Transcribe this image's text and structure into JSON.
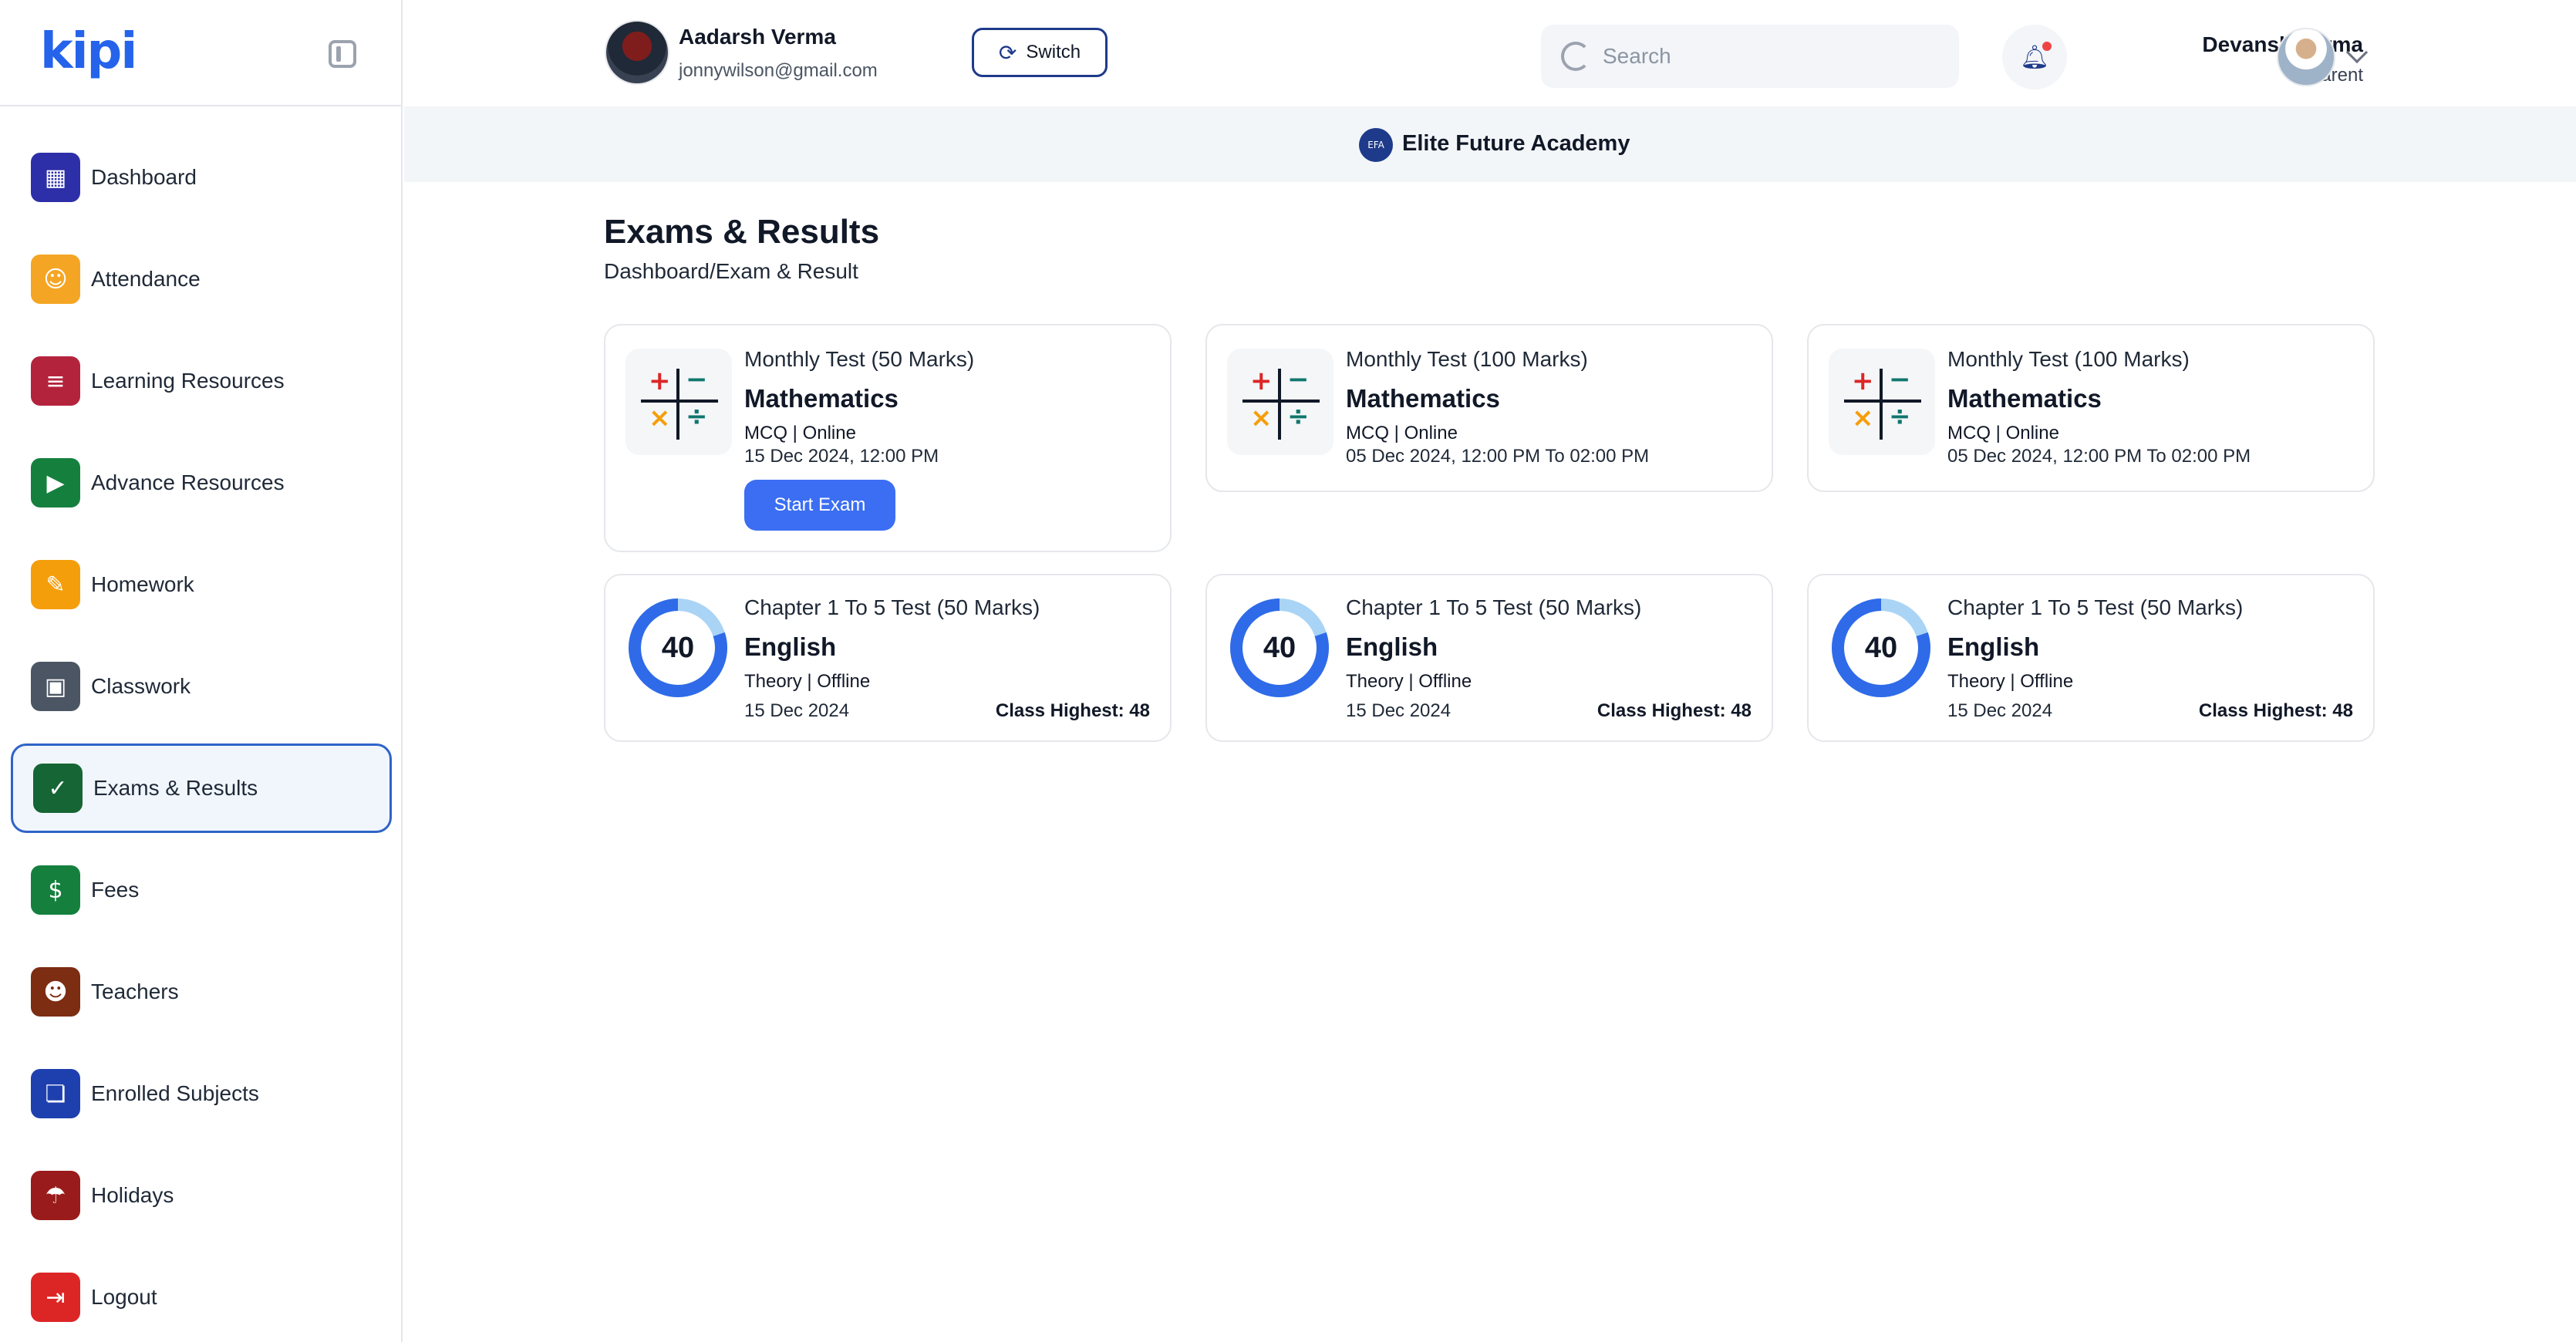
{
  "app": {
    "logo": "kipi"
  },
  "sidebar": {
    "items": [
      {
        "label": "Dashboard",
        "icon": "dashboard-icon",
        "color": "#2d2fa8",
        "glyph": "▦"
      },
      {
        "label": "Attendance",
        "icon": "attendance-icon",
        "color": "#f5a524",
        "glyph": "☺"
      },
      {
        "label": "Learning Resources",
        "icon": "learning-resources-icon",
        "color": "#b4233c",
        "glyph": "≡"
      },
      {
        "label": "Advance Resources",
        "icon": "advance-resources-icon",
        "color": "#15803d",
        "glyph": "▶"
      },
      {
        "label": "Homework",
        "icon": "homework-icon",
        "color": "#f59e0b",
        "glyph": "✎"
      },
      {
        "label": "Classwork",
        "icon": "classwork-icon",
        "color": "#4b5563",
        "glyph": "▣"
      },
      {
        "label": "Exams & Results",
        "icon": "exams-results-icon",
        "color": "#166534",
        "glyph": "✓"
      },
      {
        "label": "Fees",
        "icon": "fees-icon",
        "color": "#15803d",
        "glyph": "$"
      },
      {
        "label": "Teachers",
        "icon": "teachers-icon",
        "color": "#7c2d12",
        "glyph": "☻"
      },
      {
        "label": "Enrolled Subjects",
        "icon": "enrolled-subjects-icon",
        "color": "#1e40af",
        "glyph": "❏"
      },
      {
        "label": "Holidays",
        "icon": "holidays-icon",
        "color": "#991b1b",
        "glyph": "☂"
      },
      {
        "label": "Logout",
        "icon": "logout-icon",
        "color": "#dc2626",
        "glyph": "⇥"
      }
    ],
    "active": "Exams & Results"
  },
  "header": {
    "student": {
      "name": "Aadarsh Verma",
      "email": "jonnywilson@gmail.com"
    },
    "switch_label": "Switch",
    "search_placeholder": "Search",
    "parent": {
      "name": "Devansh Verma",
      "role": "Parent"
    }
  },
  "academy": {
    "name": "Elite Future Academy",
    "logo_text": "EFA"
  },
  "page": {
    "title": "Exams & Results",
    "breadcrumb": "Dashboard/Exam & Result"
  },
  "exams": [
    {
      "type": "Monthly Test (50 Marks)",
      "subject": "Mathematics",
      "mode": "MCQ | Online",
      "date": "15 Dec 2024, 12:00 PM",
      "action": "Start Exam"
    },
    {
      "type": "Monthly Test (100 Marks)",
      "subject": "Mathematics",
      "mode": "MCQ | Online",
      "date": "05 Dec 2024, 12:00 PM To 02:00 PM"
    },
    {
      "type": "Monthly Test (100 Marks)",
      "subject": "Mathematics",
      "mode": "MCQ | Online",
      "date": "05 Dec 2024, 12:00 PM To 02:00 PM"
    }
  ],
  "results": [
    {
      "type": "Chapter 1 To 5 Test (50 Marks)",
      "subject": "English",
      "mode": "Theory | Offline",
      "date": "15 Dec 2024",
      "score": "40",
      "score_fraction": 0.8,
      "class_highest": "Class Highest: 48"
    },
    {
      "type": "Chapter 1 To 5 Test (50 Marks)",
      "subject": "English",
      "mode": "Theory | Offline",
      "date": "15 Dec 2024",
      "score": "40",
      "score_fraction": 0.8,
      "class_highest": "Class Highest: 48"
    },
    {
      "type": "Chapter 1 To 5 Test (50 Marks)",
      "subject": "English",
      "mode": "Theory | Offline",
      "date": "15 Dec 2024",
      "score": "40",
      "score_fraction": 0.8,
      "class_highest": "Class Highest: 48"
    }
  ],
  "colors": {
    "accent": "#2f64c8",
    "button": "#3b6ef2",
    "donut_fill": "#2f6be8",
    "donut_track": "#a9d4f5"
  }
}
